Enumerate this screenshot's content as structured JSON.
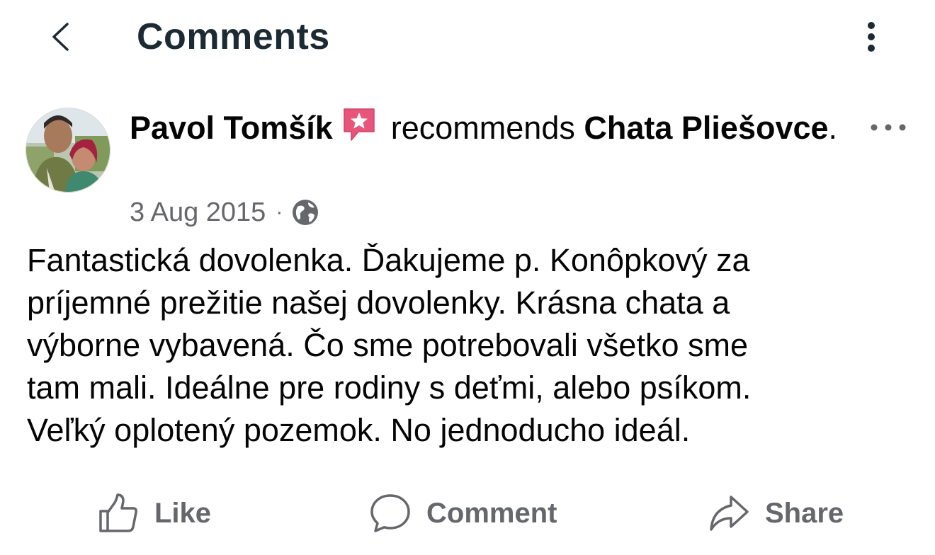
{
  "header": {
    "title": "Comments",
    "back_icon": "chevron-left-icon",
    "menu_icon": "vertical-ellipsis-icon"
  },
  "post": {
    "author": "Pavol Tomšík",
    "badge_icon": "recommend-star-icon",
    "badge_color": "#e8557a",
    "action_text": "recommends",
    "page_name": "Chata Pliešovce",
    "page_suffix": ".",
    "date": "3 Aug 2015",
    "separator": "·",
    "privacy_icon": "globe-icon",
    "more_icon": "horizontal-ellipsis-icon",
    "body": "Fantastická dovolenka. Ďakujeme p. Konôpkový za\npríjemné prežitie našej dovolenky. Krásna chata a\nvýborne vybavená. Čo sme potrebovali všetko sme\ntam mali. Ideálne pre rodiny s deťmi, alebo psíkom.\nVeľký oplotený pozemok. No jednoducho ideál."
  },
  "actions": {
    "like_label": "Like",
    "comment_label": "Comment",
    "share_label": "Share"
  },
  "colors": {
    "title": "#1c2b33",
    "text": "#050505",
    "secondary": "#65676b",
    "background": "#ffffff"
  }
}
